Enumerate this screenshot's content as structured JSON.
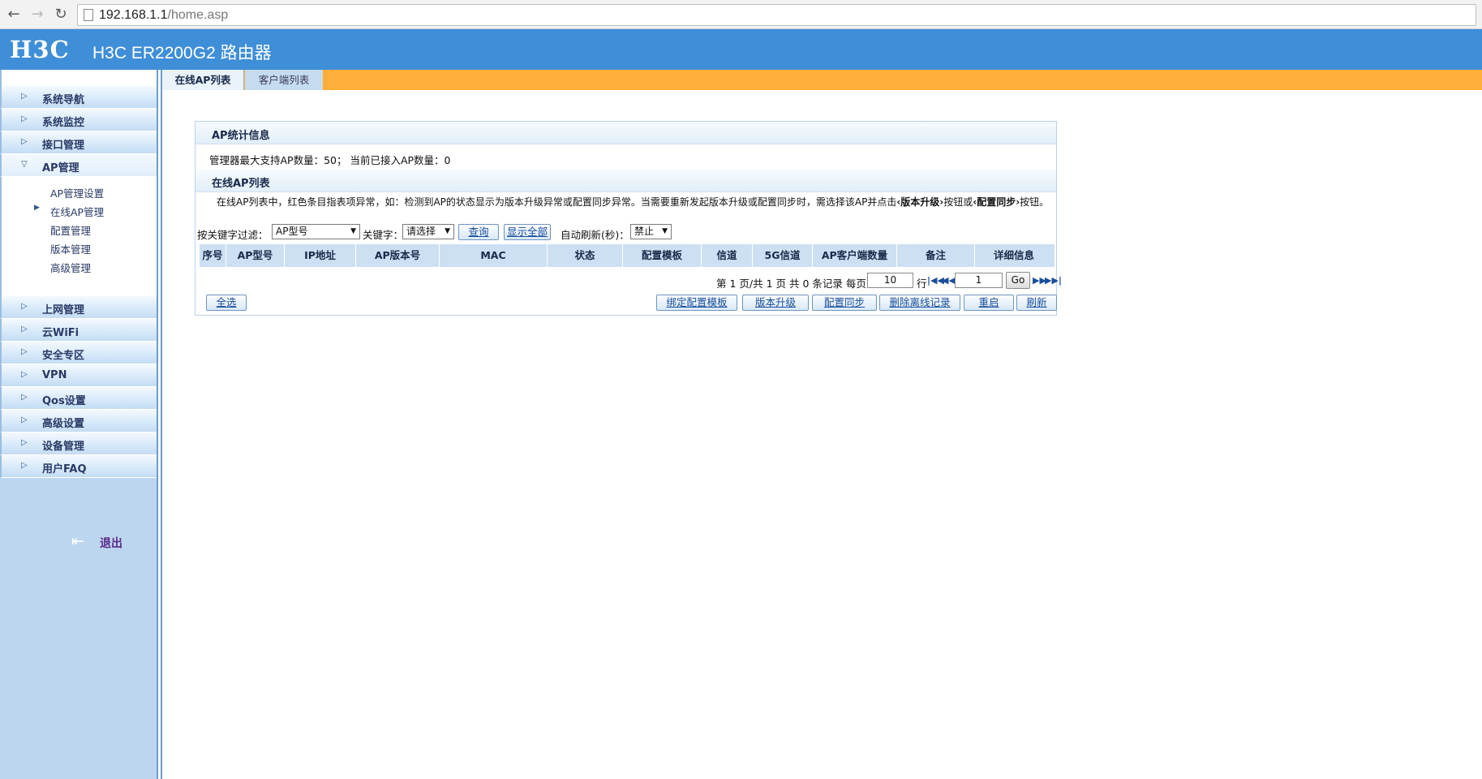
{
  "browser": {
    "back_icon": "arrow-left-icon",
    "forward_icon": "arrow-right-icon",
    "reload_icon": "reload-icon",
    "url_host": "192.168.1.1",
    "url_path": "/home.asp"
  },
  "header": {
    "logo": "H3C",
    "title": "H3C ER2200G2 路由器",
    "bg_color": "#3f8ed8"
  },
  "sidebar": {
    "menu_top": [
      {
        "label": "系统导航"
      },
      {
        "label": "系统监控"
      },
      {
        "label": "接口管理"
      }
    ],
    "expanded": {
      "label": "AP管理",
      "children": [
        {
          "label": "AP管理设置"
        },
        {
          "label": "在线AP管理"
        },
        {
          "label": "配置管理"
        },
        {
          "label": "版本管理"
        },
        {
          "label": "高级管理"
        }
      ]
    },
    "menu_bottom": [
      {
        "label": "上网管理"
      },
      {
        "label": "云WiFi"
      },
      {
        "label": "安全专区"
      },
      {
        "label": "VPN"
      },
      {
        "label": "Qos设置"
      },
      {
        "label": "高级设置"
      },
      {
        "label": "设备管理"
      },
      {
        "label": "用户FAQ"
      }
    ],
    "logout_label": "退出"
  },
  "tabs": [
    {
      "label": "在线AP列表",
      "active": true
    },
    {
      "label": "客户端列表",
      "active": false
    }
  ],
  "panel": {
    "stats_title": "AP统计信息",
    "stats_line": "管理器最大支持AP数量：50； 当前已接入AP数量：0",
    "list_title": "在线AP列表",
    "desc_prefix": "在线AP列表中，红色条目指表项异常，如：检测到AP的状态显示为版本升级异常或配置同步异常。当需要重新发起版本升级或配置同步时，需选择该AP并点击",
    "desc_bold1": "‹版本升级›",
    "desc_mid": "按钮或",
    "desc_bold2": "‹配置同步›",
    "desc_suffix": "按钮。",
    "filter": {
      "label": "按关键字过滤：",
      "field_value": "AP型号",
      "keyword_label": "关键字：",
      "keyword_value": "请选择",
      "query_button": "查询",
      "show_all_button": "显示全部",
      "refresh_label": "自动刷新(秒)：",
      "refresh_value": "禁止"
    },
    "table_headers": [
      "序号",
      "AP型号",
      "IP地址",
      "AP版本号",
      "MAC",
      "状态",
      "配置模板",
      "信道",
      "5G信道",
      "AP客户端数量",
      "备注",
      "详细信息"
    ],
    "pager": {
      "page_info": "第 1 页/共 1 页 共 0 条记录 每页",
      "rows_per_page": "10",
      "rows_label": "行",
      "page_number": "1",
      "go_button": "Go"
    },
    "actions": {
      "select_all": "全选",
      "bind_template": "绑定配置模板",
      "upgrade": "版本升级",
      "sync": "配置同步",
      "delete_offline": "删除离线记录",
      "reboot": "重启",
      "refresh": "刷新"
    }
  }
}
